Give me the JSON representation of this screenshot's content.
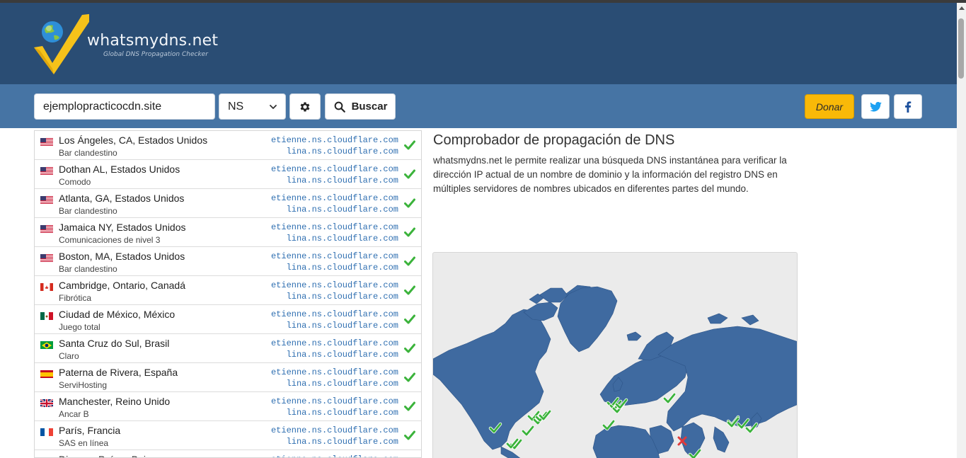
{
  "header": {
    "logo_title": "whatsmydns.net",
    "logo_subtitle": "Global DNS Propagation Checker"
  },
  "search": {
    "domain_value": "ejemplopracticocdn.site",
    "record_type": "NS",
    "search_label": "Buscar",
    "donate_label": "Donar"
  },
  "colors": {
    "header_bg": "#2a4d74",
    "searchbar_bg": "#4674a4",
    "donate_bg": "#f9b908",
    "check_green": "#3bb33b",
    "fail_red": "#e03a3a",
    "map_land": "#3f6aa0"
  },
  "results": [
    {
      "flag": "us",
      "location": "Los Ángeles, CA, Estados Unidos",
      "provider": "Bar clandestino",
      "ns1": "etienne.ns.cloudflare.com",
      "ns2": "lina.ns.cloudflare.com",
      "status": "ok"
    },
    {
      "flag": "us",
      "location": "Dothan AL, Estados Unidos",
      "provider": "Comodo",
      "ns1": "etienne.ns.cloudflare.com",
      "ns2": "lina.ns.cloudflare.com",
      "status": "ok"
    },
    {
      "flag": "us",
      "location": "Atlanta, GA, Estados Unidos",
      "provider": "Bar clandestino",
      "ns1": "etienne.ns.cloudflare.com",
      "ns2": "lina.ns.cloudflare.com",
      "status": "ok"
    },
    {
      "flag": "us",
      "location": "Jamaica NY, Estados Unidos",
      "provider": "Comunicaciones de nivel 3",
      "ns1": "etienne.ns.cloudflare.com",
      "ns2": "lina.ns.cloudflare.com",
      "status": "ok"
    },
    {
      "flag": "us",
      "location": "Boston, MA, Estados Unidos",
      "provider": "Bar clandestino",
      "ns1": "etienne.ns.cloudflare.com",
      "ns2": "lina.ns.cloudflare.com",
      "status": "ok"
    },
    {
      "flag": "ca",
      "location": "Cambridge, Ontario, Canadá",
      "provider": "Fibrótica",
      "ns1": "etienne.ns.cloudflare.com",
      "ns2": "lina.ns.cloudflare.com",
      "status": "ok"
    },
    {
      "flag": "mx",
      "location": "Ciudad de México, México",
      "provider": "Juego total",
      "ns1": "etienne.ns.cloudflare.com",
      "ns2": "lina.ns.cloudflare.com",
      "status": "ok"
    },
    {
      "flag": "br",
      "location": "Santa Cruz do Sul, Brasil",
      "provider": "Claro",
      "ns1": "etienne.ns.cloudflare.com",
      "ns2": "lina.ns.cloudflare.com",
      "status": "ok"
    },
    {
      "flag": "es",
      "location": "Paterna de Rivera, España",
      "provider": "ServiHosting",
      "ns1": "etienne.ns.cloudflare.com",
      "ns2": "lina.ns.cloudflare.com",
      "status": "ok"
    },
    {
      "flag": "gb",
      "location": "Manchester, Reino Unido",
      "provider": "Ancar B",
      "ns1": "etienne.ns.cloudflare.com",
      "ns2": "lina.ns.cloudflare.com",
      "status": "ok"
    },
    {
      "flag": "fr",
      "location": "París, Francia",
      "provider": "SAS en línea",
      "ns1": "etienne.ns.cloudflare.com",
      "ns2": "lina.ns.cloudflare.com",
      "status": "ok"
    },
    {
      "flag": "nl",
      "location": "Diemen, Países Bajos",
      "provider": "",
      "ns1": "etienne.ns.cloudflare.com",
      "ns2": "",
      "status": "ok"
    }
  ],
  "info": {
    "title": "Comprobador de propagación de DNS",
    "description": "whatsmydns.net le permite realizar una búsqueda DNS instantánea para verificar la dirección IP actual de un nombre de dominio y la información del registro DNS en múltiples servidores de nombres ubicados en diferentes partes del mundo."
  },
  "map": {
    "markers": [
      {
        "status": "ok"
      },
      {
        "status": "ok"
      },
      {
        "status": "ok"
      },
      {
        "status": "ok"
      },
      {
        "status": "ok"
      },
      {
        "status": "ok"
      },
      {
        "status": "ok"
      },
      {
        "status": "ok"
      },
      {
        "status": "ok"
      },
      {
        "status": "ok"
      },
      {
        "status": "ok"
      },
      {
        "status": "ok"
      },
      {
        "status": "ok"
      },
      {
        "status": "ok"
      },
      {
        "status": "ok"
      },
      {
        "status": "ok"
      },
      {
        "status": "ok"
      },
      {
        "status": "fail"
      },
      {
        "status": "ok"
      },
      {
        "status": "ok"
      }
    ]
  }
}
